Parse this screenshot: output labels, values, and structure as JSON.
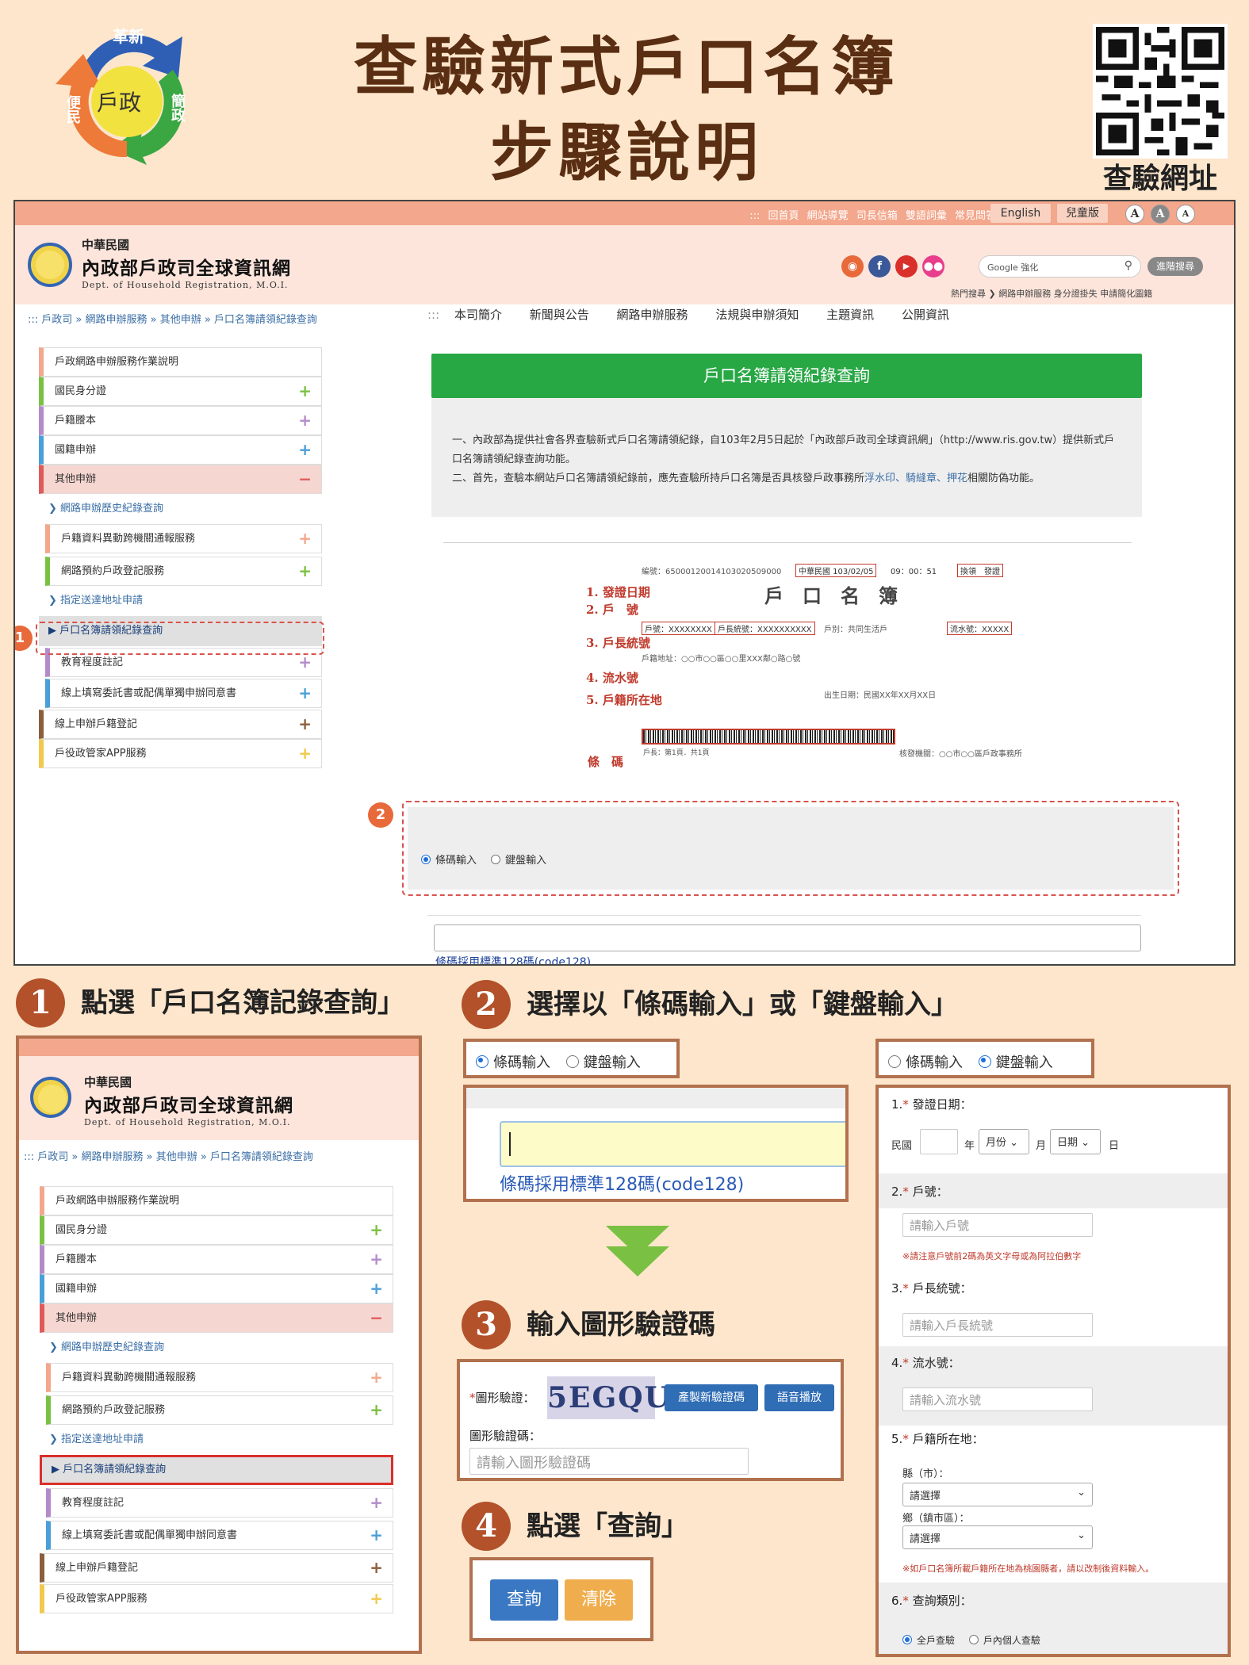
{
  "poster": {
    "title_line1": "查驗新式戶口名簿",
    "title_line2": "步驟說明",
    "qr_label": "查驗網址",
    "logo": {
      "top": "革新",
      "center": "戶政",
      "right": "簡政",
      "left": "便民"
    }
  },
  "site": {
    "topbar_links": "::: 回首頁  網站導覽  司長信箱  雙語詞彙  常見問答",
    "english_btn": "English",
    "kids_btn": "兒童版",
    "font_sizes": [
      "A",
      "A",
      "A"
    ],
    "name_line1": "中華民國",
    "name_line2": "內政部戶政司全球資訊網",
    "name_line3": "Dept. of Household Registration, M.O.I.",
    "search_placeholder": "Google 強化",
    "adv_search": "進階搜尋",
    "hot_search": "熱門搜尋 ❯ 網路申辦服務  身分證掛失  申請簡化圖籍",
    "nav": [
      "本司簡介",
      "新聞與公告",
      "網路申辦服務",
      "法規與申辦須知",
      "主題資訊",
      "公開資訊"
    ],
    "breadcrumb": "::: 戶政司 » 網路申辦服務 » 其他申辦 » 戶口名簿請領紀錄查詢"
  },
  "sidebar": {
    "items": [
      {
        "label": "戶政網路申辦服務作業說明",
        "sign": "",
        "color": "#f3a78c"
      },
      {
        "label": "國民身分證",
        "sign": "+",
        "color": "#7ac143"
      },
      {
        "label": "戶籍謄本",
        "sign": "+",
        "color": "#b38bc9"
      },
      {
        "label": "國籍申辦",
        "sign": "+",
        "color": "#4a9fd8"
      },
      {
        "label": "其他申辦",
        "sign": "−",
        "color": "#e05a5a"
      }
    ],
    "sub1": "❯ 網路申辦歷史紀錄查詢",
    "sub_items": [
      {
        "label": "戶籍資料異動跨機關通報服務",
        "sign": "+",
        "color": "#f3a78c"
      },
      {
        "label": "網路預約戶政登記服務",
        "sign": "+",
        "color": "#7ac143"
      }
    ],
    "sub2": "❯ 指定送達地址申請",
    "sub3": "▶ 戶口名簿請領紀錄查詢",
    "tail_items": [
      {
        "label": "教育程度註記",
        "sign": "+",
        "color": "#b38bc9"
      },
      {
        "label": "線上填寫委託書或配偶單獨申辦同意書",
        "sign": "+",
        "color": "#4a9fd8"
      },
      {
        "label": "線上申辦戶籍登記",
        "sign": "+",
        "color": "#8b5e3c"
      },
      {
        "label": "戶役政管家APP服務",
        "sign": "+",
        "color": "#f2c94c"
      }
    ]
  },
  "content": {
    "header": "戶口名簿請領紀錄查詢",
    "info1": "一、內政部為提供社會各界查驗新式戶口名簿請領紀錄，自103年2月5日起於「內政部戶政司全球資訊網」（http://www.ris.gov.tw）提供新式戶口名簿請領紀錄查詢功能。",
    "info2_a": "二、首先，查驗本網站戶口名簿請領紀錄前，應先查驗所持戶口名簿是否具核發戶政事務所",
    "info2_b": "浮水印、騎縫章、押花",
    "info2_c": "相關防偽功能。",
    "sample_labels": [
      "1. 發證日期",
      "2. 戶　號",
      "3. 戶長統號",
      "4. 流水號",
      "5. 戶籍所在地",
      "條　碼"
    ],
    "sample_title": "戶　口　名　簿",
    "sample_serial": "編號：65000120014103020509000",
    "sample_date": "中華民國 103/02/05",
    "sample_time": "09：00：51",
    "sample_issue": "換領　發證",
    "sample_hh": "戶號：XXXXXXXX",
    "sample_head": "戶長統號：XXXXXXXXXX",
    "sample_type": "戶別：共同生活戶",
    "sample_flow": "流水號：XXXXX",
    "sample_addr": "戶籍地址：○○市○○區○○里XXX鄰○路○號",
    "sample_birth": "出生日期：民國XX年XX月XX日",
    "sample_office": "核發機關：○○市○○區戶政事務所",
    "sample_printed": "戶長：第1頁．共1頁",
    "radio_barcode": "條碼輸入",
    "radio_keyboard": "鍵盤輸入",
    "barcode_hint": "條碼採用標準128碼(code128)",
    "badge1": "1",
    "badge2": "2"
  },
  "steps": {
    "s1_num": "1",
    "s1_text": "點選「戶口名簿記錄查詢」",
    "s2_num": "2",
    "s2_text": "選擇以「條碼輸入」或「鍵盤輸入」",
    "s3_num": "3",
    "s3_text": "輸入圖形驗證碼",
    "s4_num": "4",
    "s4_text": "點選「查詢」"
  },
  "captcha": {
    "label": "圖形驗證：",
    "image_text": "5EGQU",
    "refresh_btn": "產製新驗證碼",
    "audio_btn": "語音播放",
    "input_label": "圖形驗證碼：",
    "input_placeholder": "請輸入圖形驗證碼"
  },
  "actions": {
    "query": "查詢",
    "clear": "清除"
  },
  "keyboard_form": {
    "f1": "1.",
    "f1_label": "發證日期：",
    "roc": "民國",
    "year": "年",
    "month_sel": "月份",
    "month": "月",
    "day_sel": "日期",
    "day": "日",
    "f2": "2.",
    "f2_label": "戶號：",
    "f2_ph": "請輸入戶號",
    "f2_note": "※請注意戶號前2碼為英文字母或為阿拉伯數字",
    "f3": "3.",
    "f3_label": "戶長統號：",
    "f3_ph": "請輸入戶長統號",
    "f4": "4.",
    "f4_label": "流水號：",
    "f4_ph": "請輸入流水號",
    "f5": "5.",
    "f5_label": "戶籍所在地：",
    "county": "縣（市）：",
    "town": "鄉（鎮市區）：",
    "select_ph": "請選擇",
    "f5_note": "※如戶口名簿所載戶籍所在地為桃園縣者，請以改制後資料輸入。",
    "f6": "6.",
    "f6_label": "查詢類別：",
    "opt_all": "全戶查驗",
    "opt_one": "戶內個人查驗"
  },
  "colors": {
    "accent": "#e8693a",
    "green": "#28a745",
    "brown": "#b2512a",
    "red": "#c0392b"
  }
}
